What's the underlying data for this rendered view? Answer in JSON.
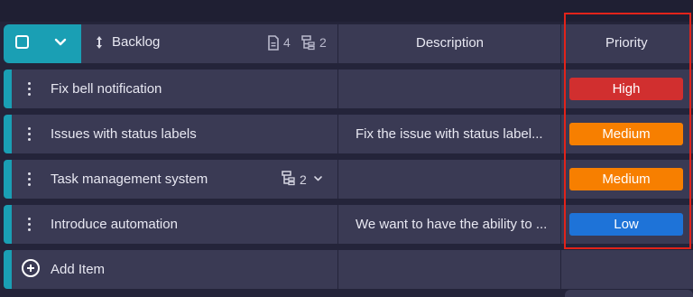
{
  "board": {
    "group_title": "Backlog",
    "file_count": "4",
    "subitem_count": "2",
    "columns": {
      "description": "Description",
      "priority": "Priority"
    },
    "rows": [
      {
        "name": "Fix bell notification",
        "description": "",
        "priority": "High",
        "priority_color": "#d12f2f"
      },
      {
        "name": "Issues with status labels",
        "description": "Fix the issue with status label...",
        "priority": "Medium",
        "priority_color": "#f77f00"
      },
      {
        "name": "Task management system",
        "description": "",
        "subitems": "2",
        "priority": "Medium",
        "priority_color": "#f77f00"
      },
      {
        "name": "Introduce automation",
        "description": "We want to have the ability to ...",
        "priority": "Low",
        "priority_color": "#1e73d8"
      }
    ],
    "add_item_label": "Add Item"
  },
  "colors": {
    "accent": "#1a9fb4",
    "highlight": "#e2231a"
  },
  "icons": [
    "checkbox-icon",
    "chevron-down-icon",
    "sort-icon",
    "file-icon",
    "subitems-icon",
    "more-vertical-icon",
    "plus-circle-icon"
  ]
}
